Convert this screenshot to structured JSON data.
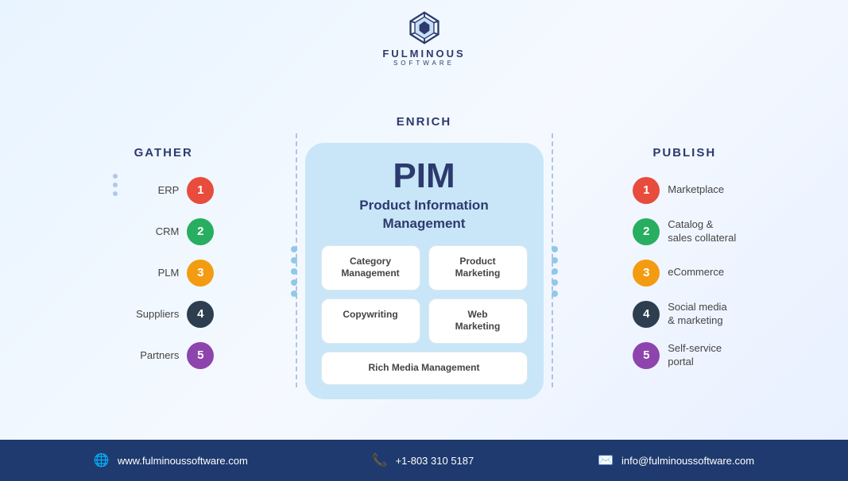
{
  "logo": {
    "text": "FULMINOUS",
    "subtext": "SOFTWARE"
  },
  "sections": {
    "gather": {
      "title": "GATHER",
      "items": [
        {
          "label": "ERP",
          "number": "1",
          "badge": "badge-red"
        },
        {
          "label": "CRM",
          "number": "2",
          "badge": "badge-green"
        },
        {
          "label": "PLM",
          "number": "3",
          "badge": "badge-orange"
        },
        {
          "label": "Suppliers",
          "number": "4",
          "badge": "badge-dark"
        },
        {
          "label": "Partners",
          "number": "5",
          "badge": "badge-purple"
        }
      ]
    },
    "enrich": {
      "title": "ENRICH",
      "pim_title": "PIM",
      "pim_subtitle": "Product Information\nManagement",
      "cells": [
        {
          "label": "Category\nManagement",
          "wide": false
        },
        {
          "label": "Product\nMarketing",
          "wide": false
        },
        {
          "label": "Copywriting",
          "wide": false
        },
        {
          "label": "Web\nMarketing",
          "wide": false
        },
        {
          "label": "Rich Media Management",
          "wide": true
        }
      ]
    },
    "publish": {
      "title": "PUBLISH",
      "items": [
        {
          "label": "Marketplace",
          "number": "1",
          "badge": "badge-red"
        },
        {
          "label": "Catalog &\nsales collateral",
          "number": "2",
          "badge": "badge-green"
        },
        {
          "label": "eCommerce",
          "number": "3",
          "badge": "badge-orange"
        },
        {
          "label": "Social media\n& marketing",
          "number": "4",
          "badge": "badge-dark"
        },
        {
          "label": "Self-service\nportal",
          "number": "5",
          "badge": "badge-purple"
        }
      ]
    }
  },
  "footer": {
    "website": "www.fulminoussoftware.com",
    "phone": "+1-803 310 5187",
    "email": "info@fulminoussoftware.com"
  }
}
